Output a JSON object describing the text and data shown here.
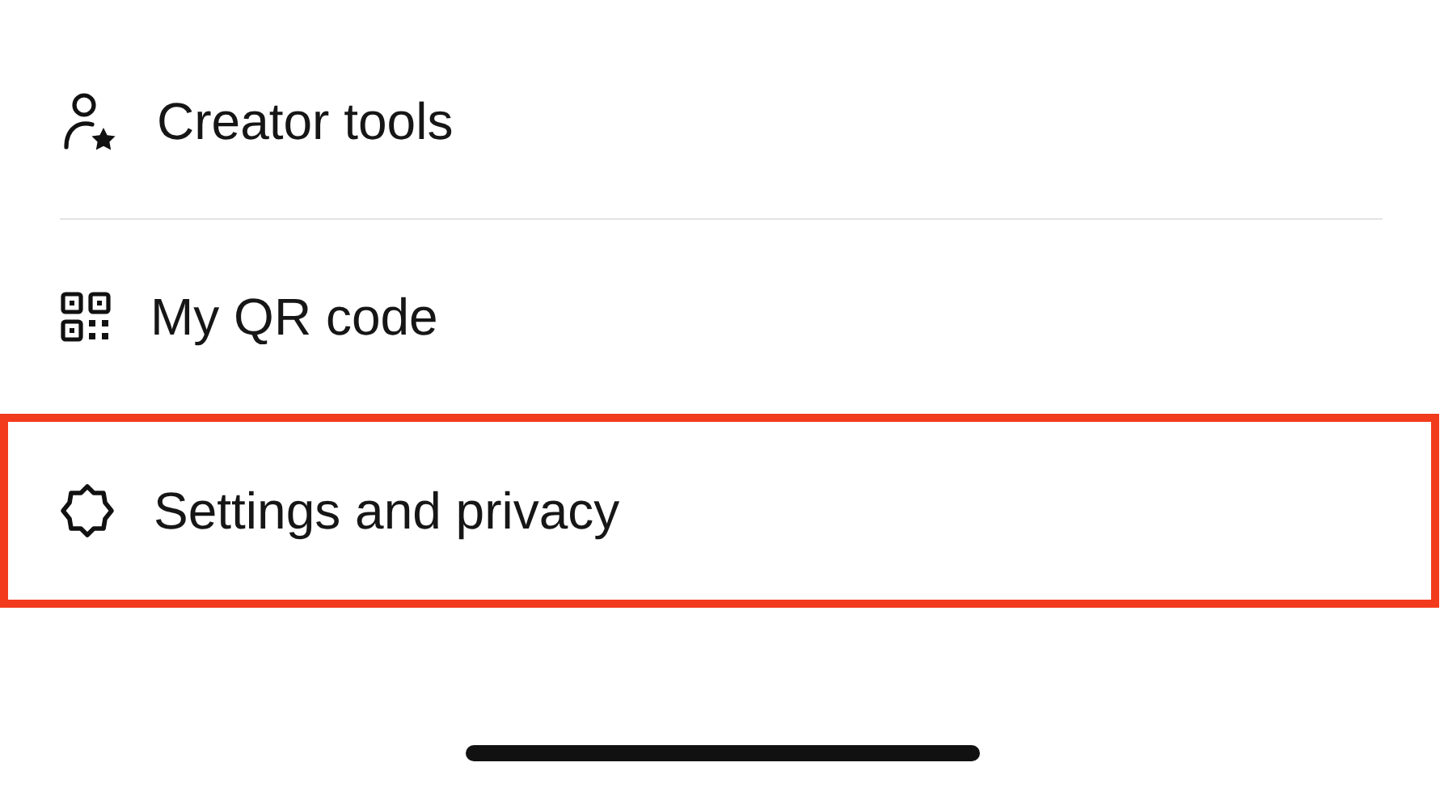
{
  "menu": {
    "items": [
      {
        "kind": "creator",
        "label": "Creator tools",
        "divider_below": true,
        "highlighted": false
      },
      {
        "kind": "qr",
        "label": "My QR code",
        "divider_below": false,
        "highlighted": false
      },
      {
        "kind": "settings",
        "label": "Settings and privacy",
        "divider_below": false,
        "highlighted": true
      }
    ]
  }
}
